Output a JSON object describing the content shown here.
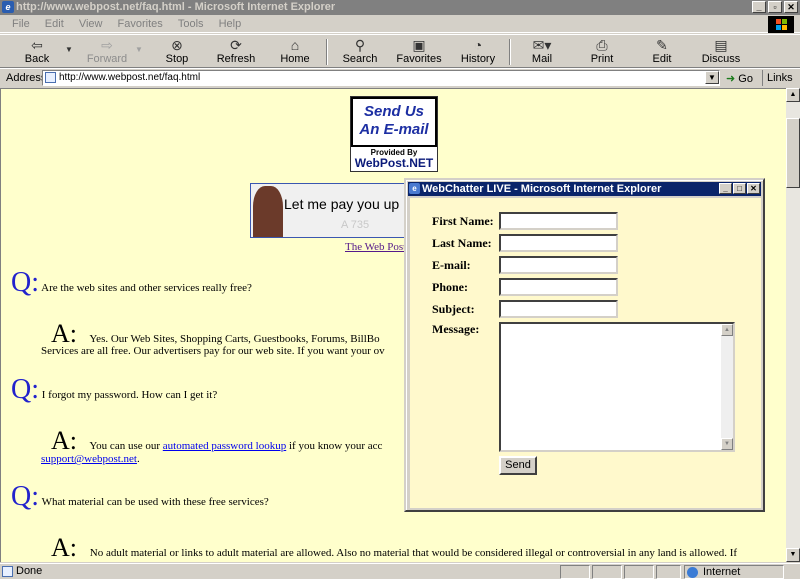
{
  "window": {
    "title": "http://www.webpost.net/faq.html - Microsoft Internet Explorer",
    "controls": [
      "_",
      "▫",
      "✕"
    ]
  },
  "menu": [
    "File",
    "Edit",
    "View",
    "Favorites",
    "Tools",
    "Help"
  ],
  "toolbar": {
    "back": "Back",
    "forward": "Forward",
    "stop": "Stop",
    "refresh": "Refresh",
    "home": "Home",
    "search": "Search",
    "favorites": "Favorites",
    "history": "History",
    "mail": "Mail",
    "print": "Print",
    "edit": "Edit",
    "discuss": "Discuss"
  },
  "address": {
    "label": "Address",
    "url": "http://www.webpost.net/faq.html",
    "go": "Go",
    "links": "Links"
  },
  "page": {
    "sendus": {
      "line1": "Send Us",
      "line2": "An E-mail",
      "provided": "Provided By",
      "brand": "WebPost.NET"
    },
    "banner_text": "Let me pay you up",
    "banner_link": "The Web Post",
    "faq": [
      {
        "q": "Q:",
        "question": "Are the web sites and other services really free?"
      },
      {
        "a": "A:",
        "answer_line1": "Yes. Our Web Sites, Shopping Carts, Guestbooks, Forums, BillBo",
        "answer_line2": "Services are all free. Our advertisers pay for our web site. If you want your ov"
      },
      {
        "q": "Q:",
        "question": "I forgot my password. How can I get it?"
      },
      {
        "a": "A:",
        "answer_pre": "You can use our ",
        "answer_link": "automated password lookup",
        "answer_post": " if you know your acc",
        "answer_email": "support@webpost.net",
        "answer_end": "."
      },
      {
        "q": "Q:",
        "question": "What material can be used with these free services?"
      },
      {
        "a": "A:",
        "answer_line1": "No adult material or links to adult material are allowed. Also no material that would be considered illegal or controversial in any land is allowed. If"
      }
    ]
  },
  "popup": {
    "title": "WebChatter LIVE - Microsoft Internet Explorer",
    "fields": {
      "first_name": "First Name:",
      "last_name": "Last Name:",
      "email": "E-mail:",
      "phone": "Phone:",
      "subject": "Subject:",
      "message": "Message:"
    },
    "send": "Send"
  },
  "status": {
    "text": "Done",
    "zone": "Internet"
  }
}
